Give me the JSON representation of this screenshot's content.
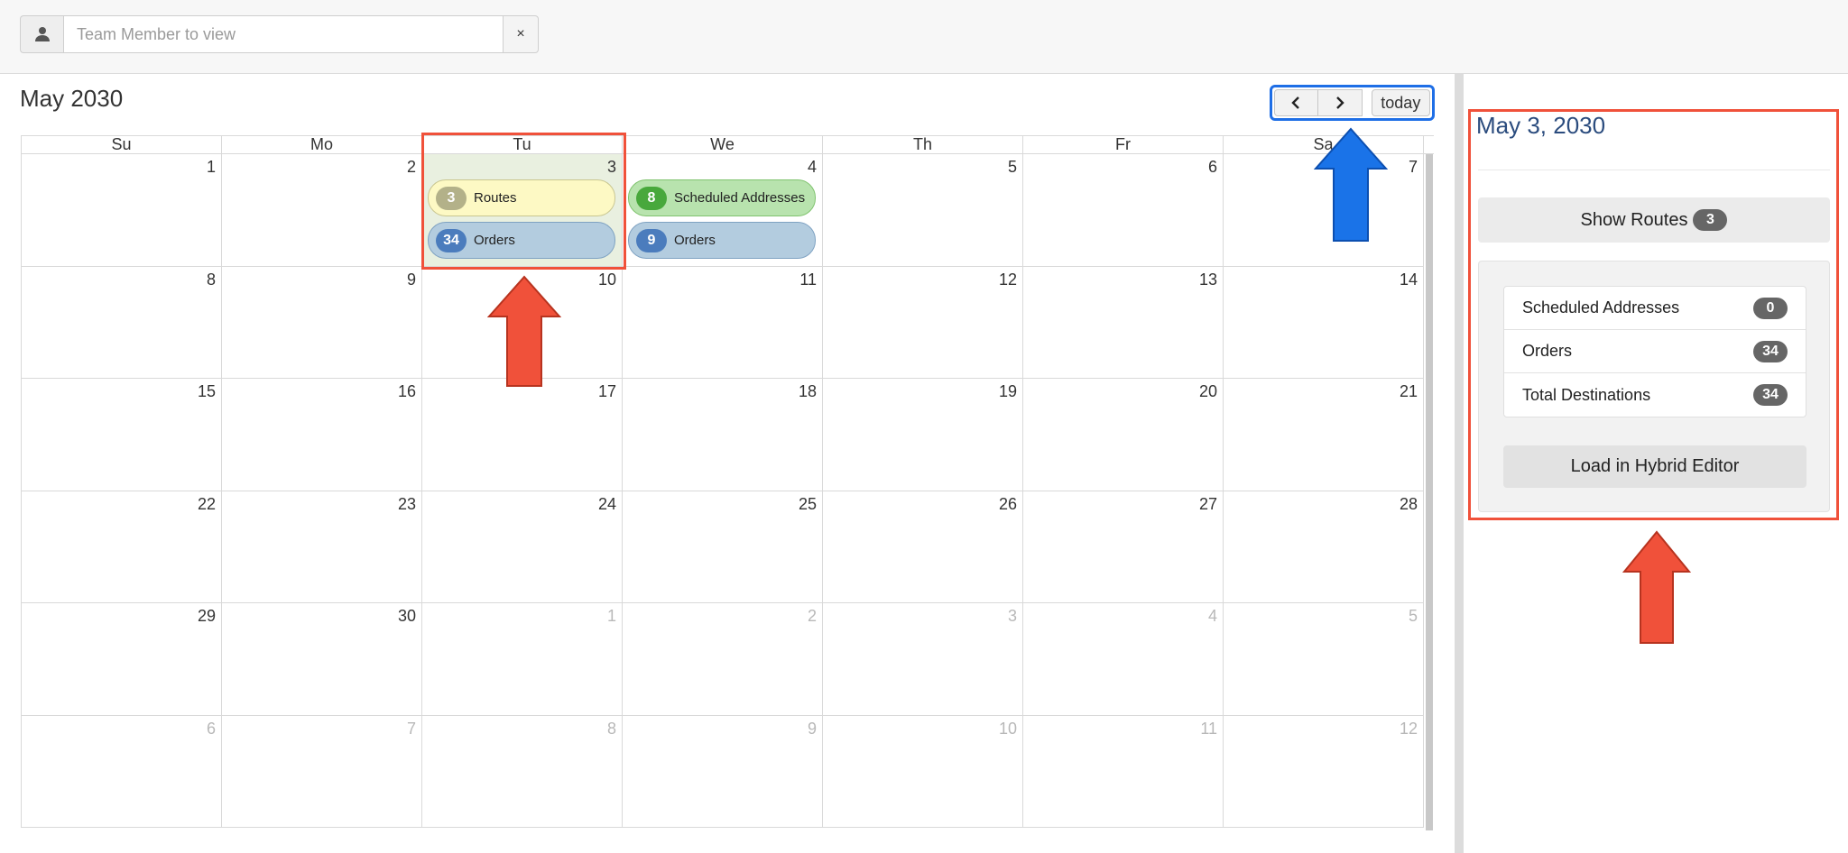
{
  "filter": {
    "placeholder": "Team Member to view",
    "clear_label": "×"
  },
  "calendar": {
    "title": "May 2030",
    "nav": {
      "prev": "‹",
      "next": "›",
      "today": "today"
    },
    "weekdays": [
      "Su",
      "Mo",
      "Tu",
      "We",
      "Th",
      "Fr",
      "Sa"
    ],
    "weeks": [
      [
        "1",
        "2",
        "3",
        "4",
        "5",
        "6",
        "7"
      ],
      [
        "8",
        "9",
        "10",
        "11",
        "12",
        "13",
        "14"
      ],
      [
        "15",
        "16",
        "17",
        "18",
        "19",
        "20",
        "21"
      ],
      [
        "22",
        "23",
        "24",
        "25",
        "26",
        "27",
        "28"
      ],
      [
        "29",
        "30",
        "1",
        "2",
        "3",
        "4",
        "5"
      ],
      [
        "6",
        "7",
        "8",
        "9",
        "10",
        "11",
        "12"
      ]
    ],
    "events": {
      "may3": [
        {
          "count": "3",
          "label": "Routes",
          "color": "#fdf9c4"
        },
        {
          "count": "34",
          "label": "Orders",
          "color": "#b3ccdf"
        }
      ],
      "may4": [
        {
          "count": "8",
          "label": "Scheduled Addresses",
          "color": "#b8e3ae"
        },
        {
          "count": "9",
          "label": "Orders",
          "color": "#b3ccdf"
        }
      ]
    }
  },
  "panel": {
    "date": "May 3, 2030",
    "show_routes": {
      "label": "Show Routes",
      "count": "3"
    },
    "stats": [
      {
        "label": "Scheduled Addresses",
        "value": "0"
      },
      {
        "label": "Orders",
        "value": "34"
      },
      {
        "label": "Total Destinations",
        "value": "34"
      }
    ],
    "load_button": "Load in Hybrid Editor"
  },
  "colors": {
    "highlight_red": "#f0513a",
    "highlight_blue": "#1e6ee6",
    "arrow_blue": "#1a73e8"
  }
}
